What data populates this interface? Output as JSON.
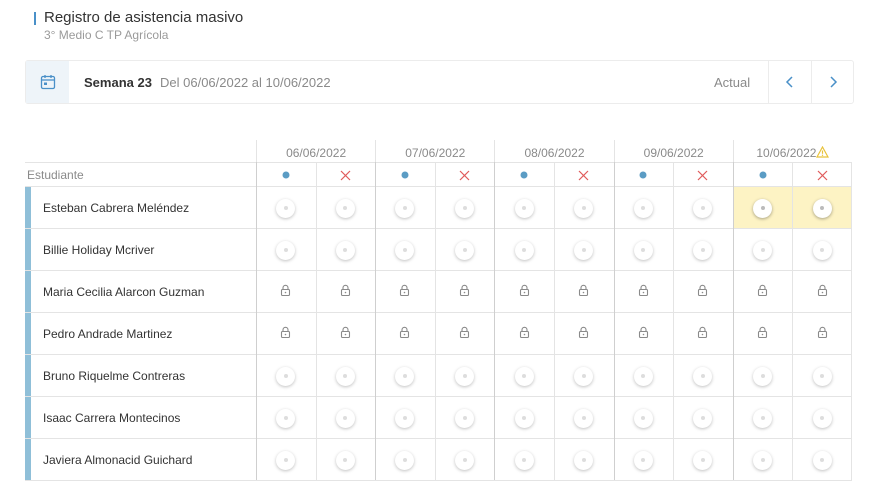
{
  "header": {
    "title": "Registro de asistencia masivo",
    "subtitle": "3° Medio C TP Agrícola"
  },
  "week": {
    "label": "Semana 23",
    "range": "Del 06/06/2022 al 10/06/2022",
    "current": "Actual",
    "prev_icon": "chevron-left-icon",
    "next_icon": "chevron-right-icon",
    "calendar_icon": "calendar-icon"
  },
  "table": {
    "student_header": "Estudiante",
    "dates": [
      "06/06/2022",
      "07/06/2022",
      "08/06/2022",
      "09/06/2022",
      "10/06/2022"
    ],
    "warning_date_index": 4,
    "column_types": [
      "present-dot-icon",
      "absent-x-icon"
    ],
    "students": [
      {
        "name": "Esteban Cabrera Meléndez",
        "state": "radio",
        "highlight_day": 4
      },
      {
        "name": "Billie Holiday Mcriver",
        "state": "radio",
        "highlight_day": -1
      },
      {
        "name": "Maria Cecilia Alarcon Guzman",
        "state": "locked",
        "highlight_day": -1
      },
      {
        "name": "Pedro Andrade Martinez",
        "state": "locked",
        "highlight_day": -1
      },
      {
        "name": "Bruno Riquelme Contreras",
        "state": "radio",
        "highlight_day": -1
      },
      {
        "name": "Isaac Carrera Montecinos",
        "state": "radio",
        "highlight_day": -1
      },
      {
        "name": "Javiera Almonacid Guichard",
        "state": "radio",
        "highlight_day": -1
      }
    ]
  },
  "colors": {
    "accent": "#4a90c8",
    "row_accent": "#8fbfd8",
    "present_dot": "#5b9cc4",
    "absent_x": "#e05a5a",
    "warning": "#e8c23a",
    "highlight": "#fdf3c4"
  }
}
